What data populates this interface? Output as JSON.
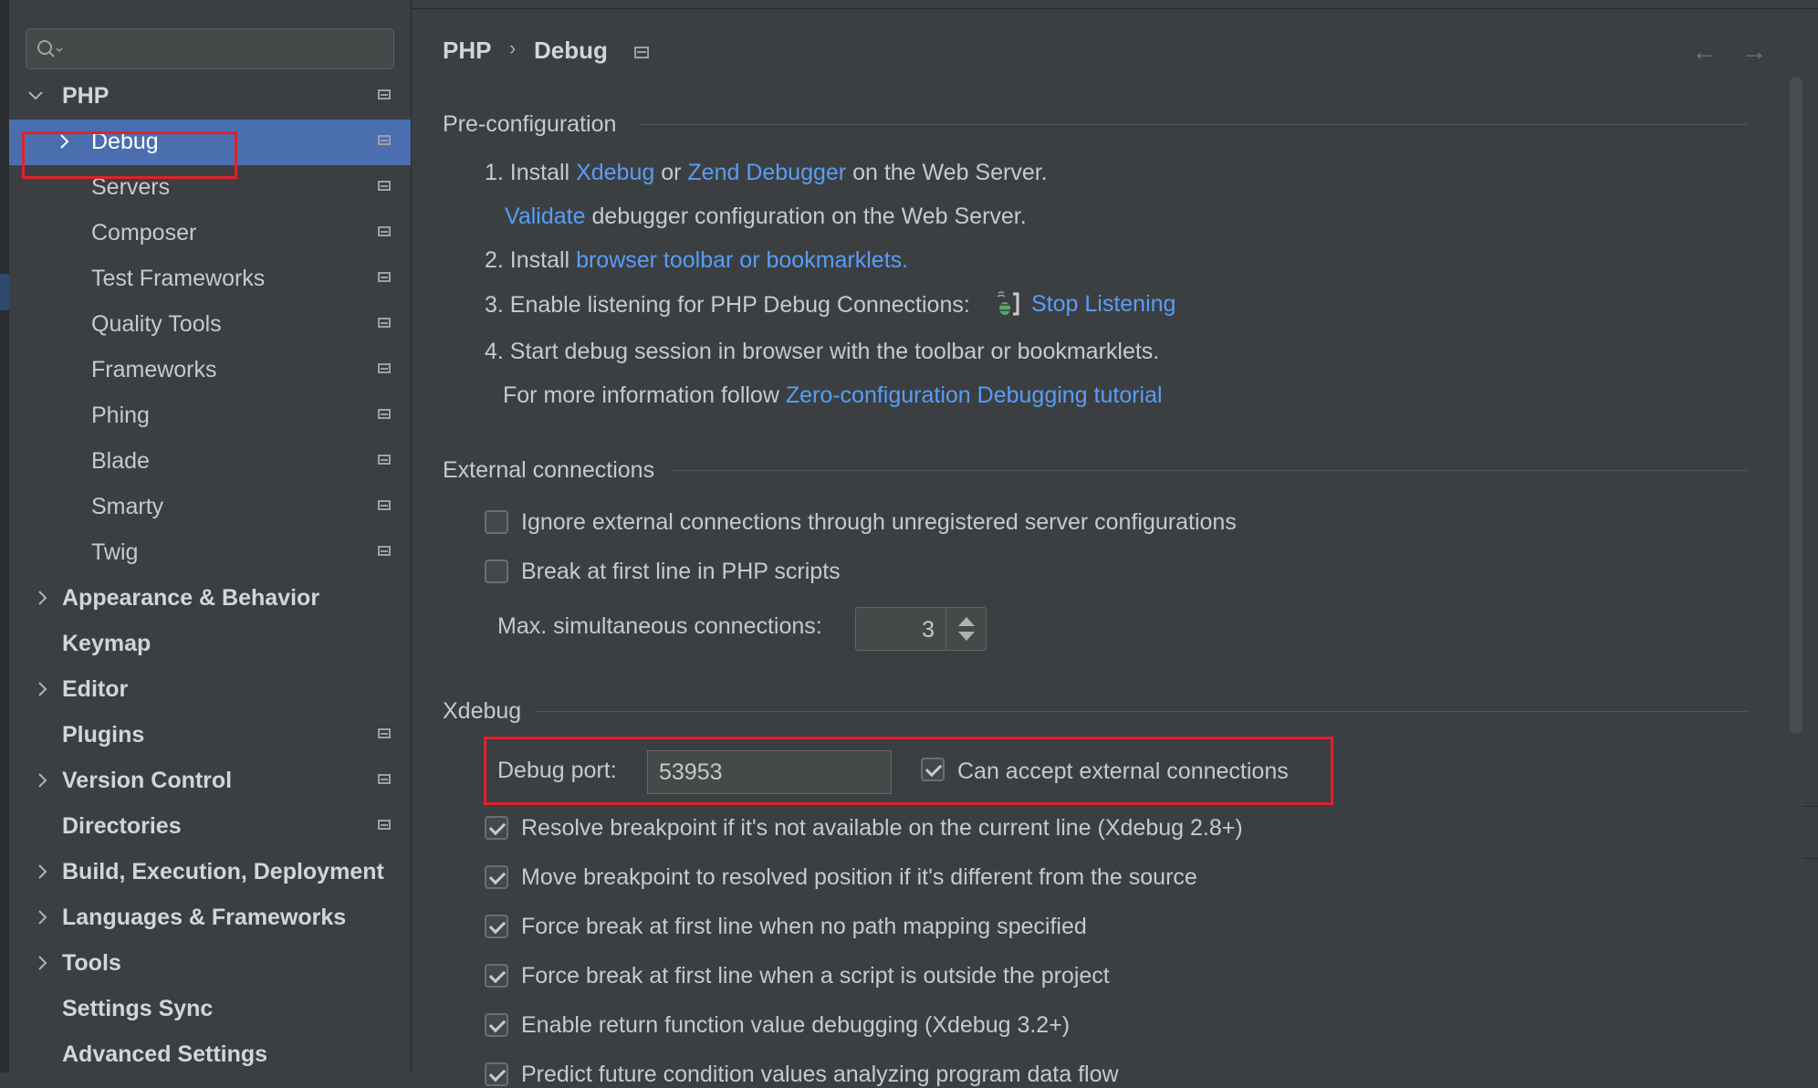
{
  "sidebar": {
    "search_placeholder": "",
    "items": [
      {
        "label": "PHP"
      },
      {
        "label": "Debug"
      },
      {
        "label": "Servers"
      },
      {
        "label": "Composer"
      },
      {
        "label": "Test Frameworks"
      },
      {
        "label": "Quality Tools"
      },
      {
        "label": "Frameworks"
      },
      {
        "label": "Phing"
      },
      {
        "label": "Blade"
      },
      {
        "label": "Smarty"
      },
      {
        "label": "Twig"
      },
      {
        "label": "Appearance & Behavior"
      },
      {
        "label": "Keymap"
      },
      {
        "label": "Editor"
      },
      {
        "label": "Plugins"
      },
      {
        "label": "Version Control"
      },
      {
        "label": "Directories"
      },
      {
        "label": "Build, Execution, Deployment"
      },
      {
        "label": "Languages & Frameworks"
      },
      {
        "label": "Tools"
      },
      {
        "label": "Settings Sync"
      },
      {
        "label": "Advanced Settings"
      }
    ]
  },
  "breadcrumb": {
    "parent": "PHP",
    "separator": "›",
    "current": "Debug"
  },
  "nav": {
    "back": "←",
    "forward": "→"
  },
  "preconfig": {
    "title": "Pre-configuration",
    "s1_prefix": "1. Install ",
    "s1_link1": "Xdebug",
    "s1_or": " or ",
    "s1_link2": "Zend Debugger",
    "s1_suffix": " on the Web Server.",
    "validate_link": "Validate",
    "validate_suffix": " debugger configuration on the Web Server.",
    "s2_prefix": "2. Install ",
    "s2_link": "browser toolbar or bookmarklets.",
    "s3_text": "3. Enable listening for PHP Debug Connections:",
    "s3_link": "Stop Listening",
    "s4_text": "4. Start debug session in browser with the toolbar or bookmarklets.",
    "more_prefix": "For more information follow ",
    "more_link": "Zero-configuration Debugging tutorial"
  },
  "external": {
    "title": "External connections",
    "ignore_label": "Ignore external connections through unregistered server configurations",
    "break_label": "Break at first line in PHP scripts",
    "max_label": "Max. simultaneous connections:",
    "max_value": "3"
  },
  "xdebug": {
    "title": "Xdebug",
    "port_label": "Debug port:",
    "port_value": "53953",
    "accept_label": "Can accept external connections",
    "options": [
      "Resolve breakpoint if it's not available on the current line (Xdebug 2.8+)",
      "Move breakpoint to resolved position if it's different from the source",
      "Force break at first line when no path mapping specified",
      "Force break at first line when a script is outside the project",
      "Enable return function value debugging (Xdebug 3.2+)",
      "Predict future condition values analyzing program data flow"
    ]
  },
  "colors": {
    "selection": "#4b6eaf",
    "link": "#589df6",
    "highlight": "#e0212b"
  }
}
